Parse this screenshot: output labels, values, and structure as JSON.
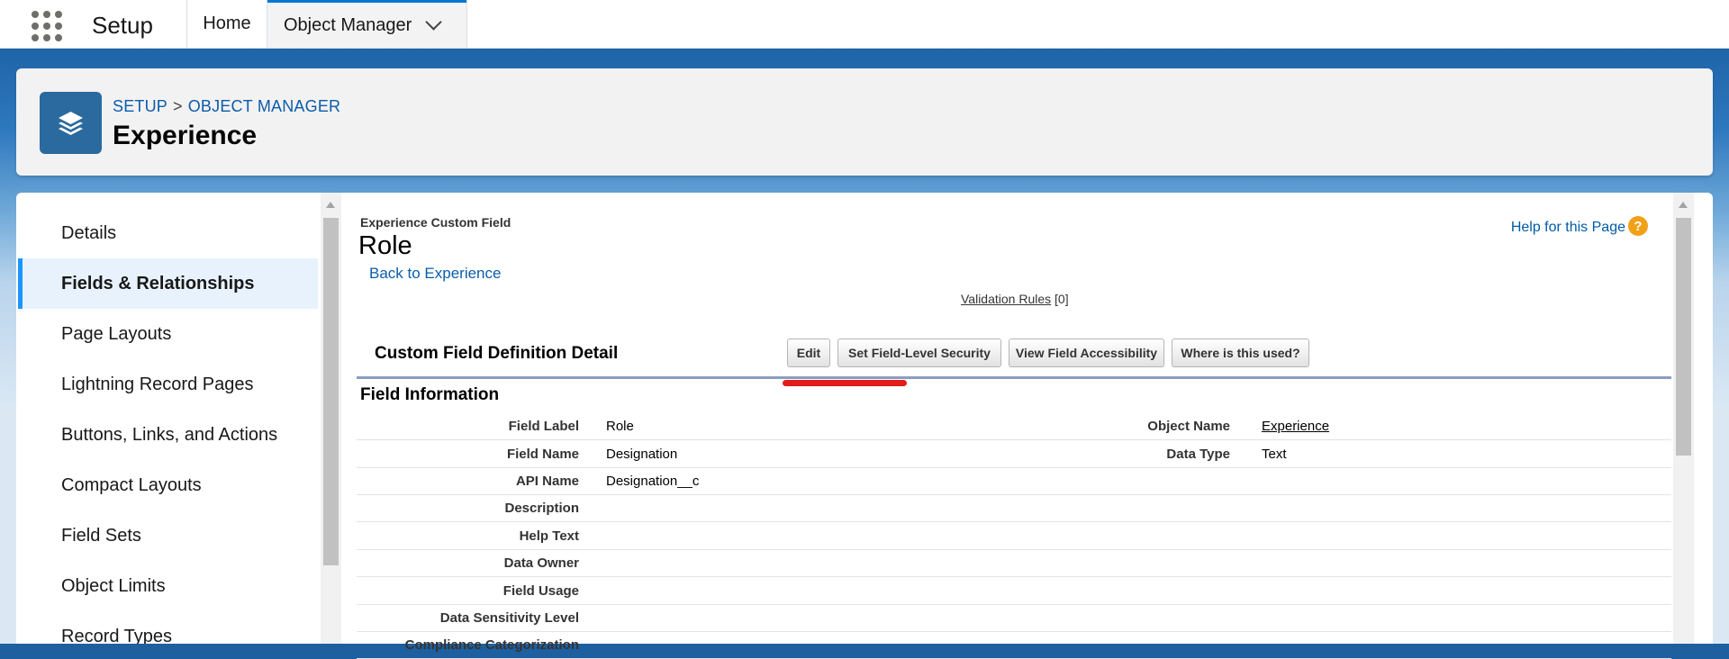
{
  "topbar": {
    "app_title": "Setup",
    "nav": {
      "home": "Home",
      "object_manager": "Object Manager"
    }
  },
  "header": {
    "breadcrumb": {
      "setup": "SETUP",
      "sep": ">",
      "object_manager": "OBJECT MANAGER"
    },
    "title": "Experience",
    "icon": "stacked-layers-icon"
  },
  "sidebar": {
    "items": [
      {
        "label": "Details"
      },
      {
        "label": "Fields & Relationships",
        "active": true
      },
      {
        "label": "Page Layouts"
      },
      {
        "label": "Lightning Record Pages"
      },
      {
        "label": "Buttons, Links, and Actions"
      },
      {
        "label": "Compact Layouts"
      },
      {
        "label": "Field Sets"
      },
      {
        "label": "Object Limits"
      },
      {
        "label": "Record Types"
      }
    ]
  },
  "content": {
    "sub_label": "Experience Custom Field",
    "title": "Role",
    "back_link": "Back to Experience",
    "help_link": "Help for this Page",
    "help_icon": "?",
    "validation_rules": {
      "label": "Validation Rules",
      "count": "[0]"
    },
    "section_title": "Custom Field Definition Detail",
    "buttons": {
      "edit": "Edit",
      "field_level_security": "Set Field-Level Security",
      "view_accessibility": "View Field Accessibility",
      "where_used": "Where is this used?"
    },
    "field_info_title": "Field Information",
    "rows": [
      {
        "label": "Field Label",
        "value": "Role",
        "label2": "Object Name",
        "value2": "Experience"
      },
      {
        "label": "Field Name",
        "value": "Designation",
        "label2": "Data Type",
        "value2": "Text"
      },
      {
        "label": "API Name",
        "value": "Designation__c",
        "label2": "",
        "value2": ""
      },
      {
        "label": "Description",
        "value": "",
        "label2": "",
        "value2": ""
      },
      {
        "label": "Help Text",
        "value": "",
        "label2": "",
        "value2": ""
      },
      {
        "label": "Data Owner",
        "value": "",
        "label2": "",
        "value2": ""
      },
      {
        "label": "Field Usage",
        "value": "",
        "label2": "",
        "value2": ""
      },
      {
        "label": "Data Sensitivity Level",
        "value": "",
        "label2": "",
        "value2": ""
      },
      {
        "label": "Compliance Categorization",
        "value": "",
        "label2": "",
        "value2": ""
      }
    ]
  },
  "colors": {
    "brand_blue": "#0176d3",
    "link_blue": "#0b5cab",
    "active_bg": "#e8f2fd",
    "annotation_red": "#e21b1b",
    "help_orange": "#f0a117"
  }
}
